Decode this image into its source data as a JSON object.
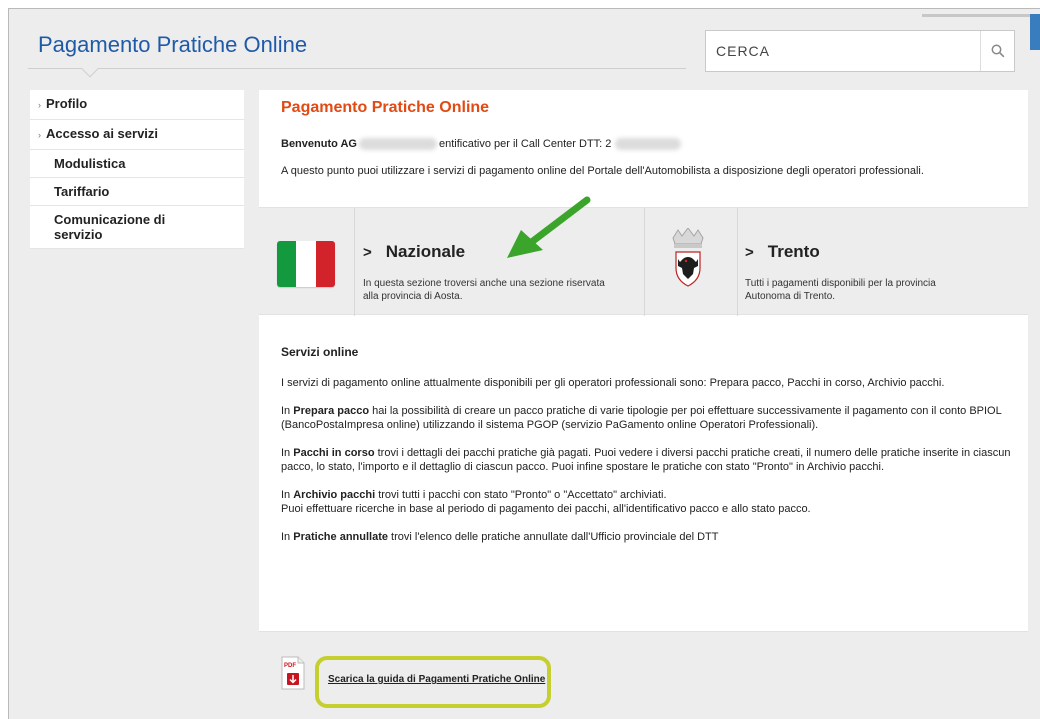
{
  "header": {
    "site_title": "Pagamento Pratiche Online",
    "search_placeholder": "CERCA",
    "search_icon": "magnifier-icon"
  },
  "sidebar": {
    "items": [
      {
        "label": "Profilo",
        "arrow": "›"
      },
      {
        "label": "Accesso ai servizi",
        "arrow": "›"
      },
      {
        "label": "Modulistica"
      },
      {
        "label": "Tariffario"
      },
      {
        "label": "Comunicazione di servizio"
      }
    ]
  },
  "main": {
    "title": "Pagamento Pratiche Online",
    "welcome_prefix": "Benvenuto AG",
    "welcome_mid": "entificativo per il Call Center DTT: 2",
    "intro": "A questo punto puoi utilizzare i servizi di pagamento online del Portale dell'Automobilista a disposizione degli operatori professionali.",
    "regions": [
      {
        "chevron": ">",
        "label": "Nazionale",
        "description": "In questa sezione troversi anche una sezione riservata alla provincia di Aosta."
      },
      {
        "chevron": ">",
        "label": "Trento",
        "description": "Tutti i pagamenti disponibili per la provincia Autonoma di Trento."
      }
    ],
    "services": {
      "heading": "Servizi online",
      "p1": "I servizi di pagamento online attualmente disponibili per gli operatori professionali sono: Prepara pacco, Pacchi in corso, Archivio pacchi.",
      "p2_prefix": "In ",
      "p2_bold": "Prepara pacco",
      "p2_rest": " hai la possibilità di creare un pacco pratiche di varie tipologie per poi effettuare successivamente il pagamento con il conto BPIOL (BancoPostaImpresa online) utilizzando il sistema PGOP (servizio PaGamento online Operatori Professionali).",
      "p3_prefix": "In ",
      "p3_bold": "Pacchi in corso",
      "p3_rest": " trovi i dettagli dei pacchi pratiche già pagati. Puoi vedere i diversi pacchi pratiche creati, il numero delle pratiche inserite in ciascun pacco, lo stato, l'importo e il dettaglio di ciascun pacco. Puoi infine spostare le pratiche con stato \"Pronto\" in Archivio pacchi.",
      "p4_prefix": "In ",
      "p4_bold": "Archivio pacchi",
      "p4_rest": " trovi tutti i pacchi con stato \"Pronto\" o \"Accettato\" archiviati.",
      "p4_line2": "Puoi effettuare ricerche in base al periodo di pagamento dei pacchi, all'identificativo pacco e allo stato pacco.",
      "p5_prefix": "In ",
      "p5_bold": "Pratiche annullate",
      "p5_rest": " trovi l'elenco delle pratiche annullate dall'Ufficio provinciale del DTT"
    },
    "guide": {
      "pdf_label": "PDF",
      "link": "Scarica la guida di Pagamenti Pratiche Online"
    }
  },
  "colors": {
    "title_blue": "#1f5aa8",
    "accent_orange": "#e24a14",
    "arrow_green": "#3aa52a",
    "highlight_yellow": "#c5cf2f",
    "flag_green": "#139a3e",
    "flag_white": "#ffffff",
    "flag_red": "#d2232a"
  }
}
